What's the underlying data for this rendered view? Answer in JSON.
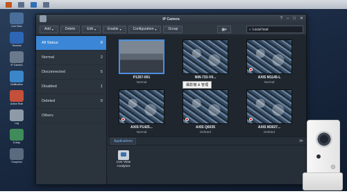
{
  "window": {
    "title": "IP Camera",
    "controls": [
      "?",
      "–",
      "□",
      "✕"
    ]
  },
  "toolbar": {
    "buttons": [
      {
        "label": "Add",
        "caret": "▾"
      },
      {
        "label": "Delete",
        "caret": ""
      },
      {
        "label": "Edit",
        "caret": "▾"
      },
      {
        "label": "Enable",
        "caret": "▾"
      },
      {
        "label": "Configuration",
        "caret": "▾"
      },
      {
        "label": "Group",
        "caret": ""
      }
    ],
    "view_label": "▦▾",
    "search_value": "Local host"
  },
  "sidebar": {
    "items": [
      {
        "label": "All Status",
        "count": "8",
        "active": true
      },
      {
        "label": "Normal",
        "count": "2",
        "active": false
      },
      {
        "label": "Disconnected",
        "count": "5",
        "active": false
      },
      {
        "label": "Disabled",
        "count": "1",
        "active": false
      },
      {
        "label": "Deleted",
        "count": "0",
        "active": false
      },
      {
        "label": "Others",
        "count": "",
        "active": false
      }
    ]
  },
  "cameras": [
    {
      "name": "P1357-001",
      "status": "Normal",
      "recording": false,
      "selected": true,
      "scene": "office"
    },
    {
      "name": "NIN-733-V0...",
      "status": "",
      "recording": false,
      "selected": false,
      "scene": "street"
    },
    {
      "name": "AXIS M1145-L",
      "status": "Normal",
      "recording": true,
      "selected": false,
      "scene": "street"
    },
    {
      "name": "AXIS P1425...",
      "status": "Normal",
      "recording": true,
      "selected": false,
      "scene": "street"
    },
    {
      "name": "AXIS Q6035",
      "status": "Deleted",
      "recording": true,
      "selected": false,
      "scene": "street"
    },
    {
      "name": "AXIS M3027...",
      "status": "Deleted",
      "recording": true,
      "selected": false,
      "scene": "street"
    }
  ],
  "tooltip": "攝影機 & 管理",
  "applications": {
    "tab_label": "Applications",
    "toggle": "≫",
    "tiles": [
      {
        "label_line1": "Live View",
        "label_line2": "Analytics"
      }
    ]
  },
  "desktop_icons": [
    {
      "label": "Live View"
    },
    {
      "label": "Timeline"
    },
    {
      "label": "IP Camera"
    },
    {
      "label": "Notification"
    },
    {
      "label": "Action Rule"
    },
    {
      "label": "Log"
    },
    {
      "label": "E-Map"
    },
    {
      "label": "Snapshot"
    }
  ]
}
